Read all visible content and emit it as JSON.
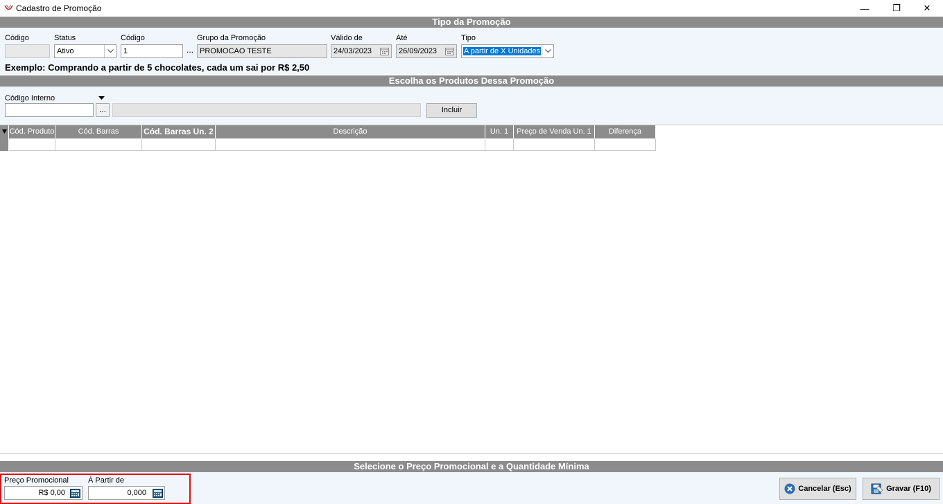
{
  "window": {
    "title": "Cadastro de Promoção",
    "minimize": "—",
    "restore": "❐",
    "close": "✕"
  },
  "tipo_section": {
    "header": "Tipo da Promoção",
    "codigo_label": "Código",
    "codigo_value": "",
    "status_label": "Status",
    "status_value": "Ativo",
    "codigo2_label": "Código",
    "codigo2_value": "1",
    "ellipsis": "...",
    "grupo_label": "Grupo da Promoção",
    "grupo_value": "PROMOCAO TESTE",
    "valido_label": "Válido de",
    "valido_value": "24/03/2023",
    "ate_label": "Até",
    "ate_value": "26/09/2023",
    "tipo_label": "Tipo",
    "tipo_value": "A partir de X Unidades",
    "example": "Exemplo: Comprando a partir de 5 chocolates, cada um sai por R$ 2,50"
  },
  "produtos_section": {
    "header": "Escolha os Produtos Dessa Promoção",
    "codigo_interno_label": "Código Interno",
    "codigo_interno_value": "",
    "ellipsis": "...",
    "descricao_value": "",
    "incluir_label": "Incluir"
  },
  "grid": {
    "columns": [
      "Cód. Produto",
      "Cód. Barras",
      "Cód. Barras Un. 2",
      "Descrição",
      "Un. 1",
      "Preço de Venda Un. 1",
      "Diferença"
    ]
  },
  "preco_section": {
    "header": "Selecione o Preço Promocional e a Quantidade Mínima",
    "preco_label": "Preço Promocional",
    "preco_value": "R$ 0,00",
    "partir_label": "À Partir de",
    "partir_value": "0,000",
    "cancel_label": "Cancelar (Esc)",
    "save_label": "Gravar (F10)"
  },
  "colors": {
    "header_bg": "#8c8c8c",
    "panel_bg": "#f0f6fc",
    "highlight": "#e01010",
    "selection": "#0078d7"
  }
}
